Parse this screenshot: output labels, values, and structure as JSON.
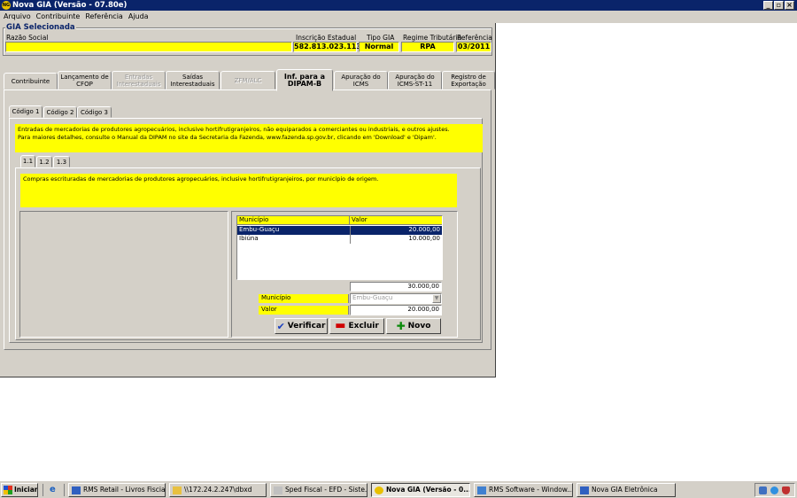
{
  "window": {
    "title": "Nova GIA (Versão - 07.80e)",
    "app_icon_text": "NG"
  },
  "menu": [
    "Arquivo",
    "Contribuinte",
    "Referência",
    "Ajuda"
  ],
  "gia": {
    "group_title": "GIA Selecionada",
    "razao_label": "Razão Social",
    "razao_value": "",
    "ie_label": "Inscrição Estadual",
    "ie_value": "582.813.023.113",
    "tipo_label": "Tipo GIA",
    "tipo_value": "Normal",
    "regime_label": "Regime Tributário",
    "regime_value": "RPA",
    "ref_label": "Referência",
    "ref_value": "03/2011"
  },
  "main_tabs": [
    {
      "label": "Contribuinte",
      "enabled": true
    },
    {
      "label": "Lançamento de CFOP",
      "enabled": true
    },
    {
      "label": "Entradas Interestaduais",
      "enabled": false
    },
    {
      "label": "Saídas Interestaduais",
      "enabled": true
    },
    {
      "label": "ZFM/ALC",
      "enabled": false
    },
    {
      "label": "Inf. para a DIPAM-B",
      "enabled": true,
      "active": true
    },
    {
      "label": "Apuração do ICMS",
      "enabled": true
    },
    {
      "label": "Apuração do ICMS-ST-11",
      "enabled": true
    },
    {
      "label": "Registro de Exportação",
      "enabled": true
    }
  ],
  "code_tabs": [
    "Código 1",
    "Código 2",
    "Código 3"
  ],
  "code_desc": {
    "line1": "Entradas de mercadorias de produtores agropecuários, inclusive hortifrutigranjeiros, não equiparados a comerciantes ou industriais, e outros ajustes.",
    "line2": "Para maiores detalhes, consulte o Manual da DIPAM no site da Secretaria da Fazenda, www.fazenda.sp.gov.br, clicando em 'Download' e 'Dipam'."
  },
  "sub_tabs": [
    "1.1",
    "1.2",
    "1.3"
  ],
  "sub_desc": "Compras escrituradas de mercadorias de produtores agropecuários, inclusive hortifrutigranjeiros, por município de origem.",
  "grid": {
    "col_municipio": "Município",
    "col_valor": "Valor",
    "rows": [
      {
        "municipio": "Embu-Guaçu",
        "valor": "20.000,00"
      },
      {
        "municipio": "Ibiúna",
        "valor": "10.000,00"
      }
    ],
    "total": "30.000,00"
  },
  "form": {
    "municipio_label": "Município",
    "municipio_value": "Embu-Guaçu",
    "valor_label": "Valor",
    "valor_value": "20.000,00"
  },
  "buttons": {
    "verificar": "Verificar",
    "excluir": "Excluir",
    "novo": "Novo"
  },
  "taskbar": {
    "start": "Iniciar",
    "items": [
      {
        "label": "RMS Retail - Livros Fiscia...",
        "pressed": false
      },
      {
        "label": "\\\\172.24.2.247\\dbxd",
        "pressed": false
      },
      {
        "label": "Sped Fiscal - EFD - Siste...",
        "pressed": false
      },
      {
        "label": "Nova GIA (Versão - 0...",
        "pressed": true
      },
      {
        "label": "RMS Software - Window...",
        "pressed": false
      },
      {
        "label": "Nova GIA Eletrônica",
        "pressed": false
      }
    ]
  },
  "colors": {
    "title_blue": "#0a246a",
    "highlight_yellow": "#ffff00",
    "selection_navy": "#0a246a",
    "face": "#d4d0c8"
  }
}
